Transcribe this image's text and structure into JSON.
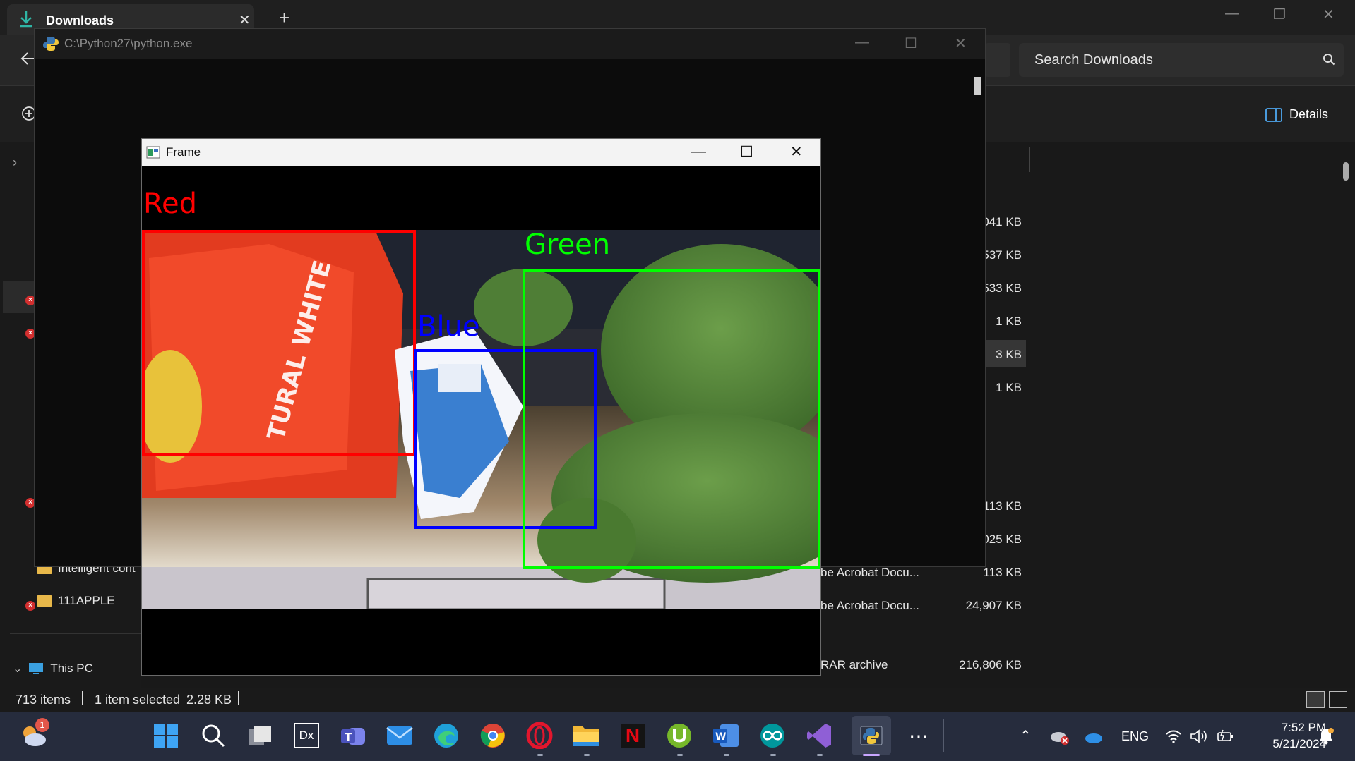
{
  "explorer": {
    "tab_title": "Downloads",
    "search_placeholder": "Search Downloads",
    "details_label": "Details",
    "status": {
      "items": "713 items",
      "selected": "1 item selected",
      "size": "2.28 KB"
    },
    "nav": {
      "folder_intelligent": "Intelligent cont",
      "folder_apple": "111APPLE",
      "this_pc": "This PC"
    },
    "sizes_top": [
      "041 KB",
      "537 KB",
      "533 KB",
      "1 KB",
      "3 KB",
      "1 KB"
    ],
    "sizes_bottom": [
      "113 KB",
      "025 KB",
      "113 KB",
      "24,907 KB",
      "216,806 KB"
    ],
    "types": [
      "be Acrobat Docu...",
      "be Acrobat Docu...",
      "RAR archive"
    ]
  },
  "console": {
    "title": "C:\\Python27\\python.exe"
  },
  "frame": {
    "title": "Frame",
    "detections": [
      {
        "label": "Red",
        "color": "#ff0000"
      },
      {
        "label": "Blue",
        "color": "#0000ff"
      },
      {
        "label": "Green",
        "color": "#00ff00"
      }
    ]
  },
  "taskbar": {
    "weather_badge": "1",
    "language": "ENG",
    "time": "7:52 PM",
    "date": "5/21/2024",
    "apps": [
      "start",
      "search",
      "task-view",
      "dx",
      "teams",
      "mail",
      "edge",
      "chrome",
      "opera",
      "file-explorer",
      "netflix",
      "utorrent",
      "word",
      "arduino",
      "visual-studio",
      "python",
      "more"
    ]
  }
}
